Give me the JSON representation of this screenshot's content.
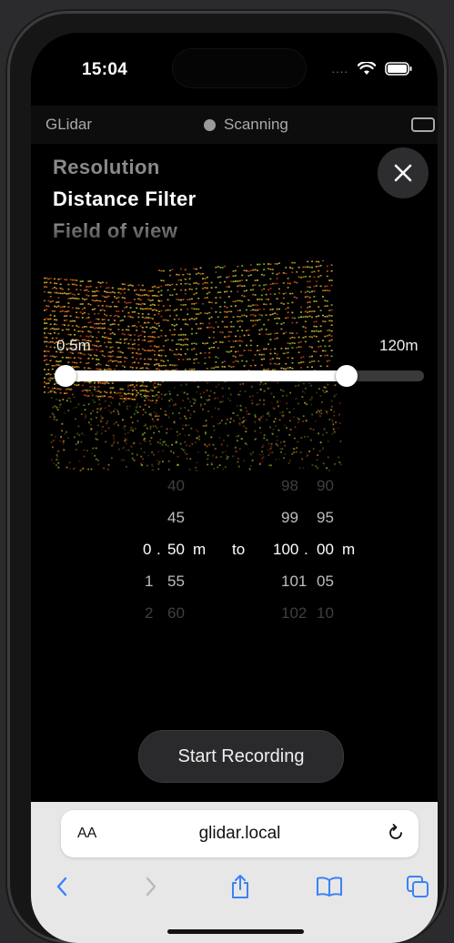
{
  "status_bar": {
    "time": "15:04",
    "signal": "....",
    "wifi": "wifi-icon",
    "battery": "battery-icon"
  },
  "app_bar": {
    "title": "GLidar",
    "status": "Scanning",
    "status_dot_color": "#9a9a9a"
  },
  "settings_menu": {
    "items": [
      "Resolution",
      "Distance Filter",
      "Field of view"
    ],
    "selected": "Distance Filter"
  },
  "range": {
    "min_label": "0.5m",
    "max_label": "120m",
    "low_fraction": 0.0,
    "high_fraction": 0.81
  },
  "picker": {
    "rows": [
      {
        "a": "",
        "b": "40",
        "c": "98",
        "d": "90"
      },
      {
        "a": "",
        "b": "45",
        "c": "99",
        "d": "95"
      },
      {
        "a": "0",
        "sep1": ".",
        "b": "50",
        "unit1": "m",
        "to": "to",
        "c": "100",
        "sep2": ".",
        "d": "00",
        "unit2": "m"
      },
      {
        "a": "1",
        "b": "55",
        "c": "101",
        "d": "05"
      },
      {
        "a": "2",
        "b": "60",
        "c": "102",
        "d": "10"
      }
    ]
  },
  "actions": {
    "start_label": "Start Recording"
  },
  "browser": {
    "aa": "AA",
    "url": "glidar.local"
  },
  "colors": {
    "accent": "#3a82f7",
    "slider_fill": "#ffffff",
    "track": "#3a3a3a"
  }
}
